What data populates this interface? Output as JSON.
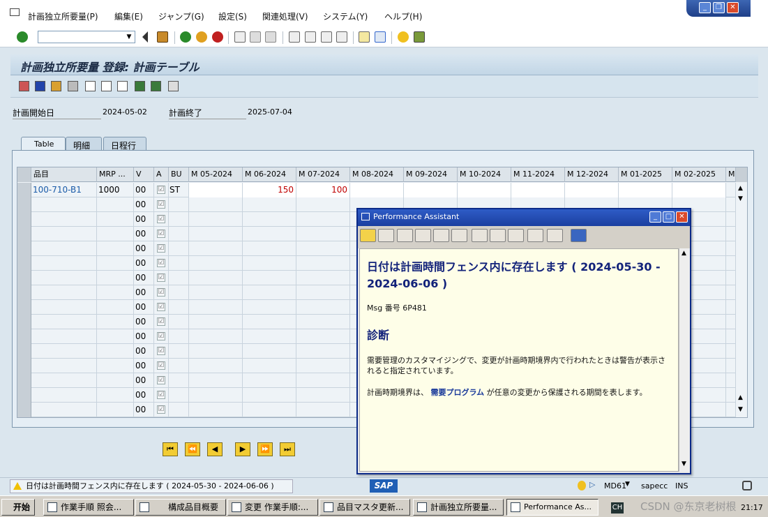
{
  "menu": [
    "計画独立所要量(P)",
    "編集(E)",
    "ジャンプ(G)",
    "設定(S)",
    "関連処理(V)",
    "システム(Y)",
    "ヘルプ(H)"
  ],
  "screen_title": "計画独立所要量 登録:  計画テーブル",
  "fields": {
    "start_label": "計画開始日",
    "start_value": "2024-05-02",
    "end_label": "計画終了",
    "end_value": "2025-07-04"
  },
  "tabs": [
    "Table",
    "明細",
    "日程行"
  ],
  "table": {
    "headers": [
      "品目",
      "MRP ...",
      "V",
      "A",
      "BU",
      "M 05-2024",
      "M 06-2024",
      "M 07-2024",
      "M 08-2024",
      "M 09-2024",
      "M 10-2024",
      "M 11-2024",
      "M 12-2024",
      "M 01-2025",
      "M 02-2025",
      "M."
    ],
    "first_row": {
      "item": "100-710-B1",
      "mrp": "1000",
      "v": "00",
      "a": "☑",
      "bu": "ST",
      "m06": "150",
      "m07": "100"
    },
    "other_v": "00",
    "check": "☑"
  },
  "nav_buttons": [
    "⏮",
    "⏪",
    "◀",
    "▶",
    "⏩",
    "⏭"
  ],
  "status": {
    "message": "日付は計画時間フェンス内に存在します ( 2024-05-30 - 2024-06-06 )",
    "sap_logo": "SAP",
    "transaction": "MD61",
    "system": "sapecc",
    "mode": "INS"
  },
  "popup": {
    "title": "Performance Assistant",
    "heading": "日付は計画時間フェンス内に存在します ( 2024-05-30 - 2024-06-06 )",
    "msg_no": "Msg 番号  6P481",
    "diag_title": "診断",
    "diag_text": "需要管理のカスタマイジングで、変更が計画時期境界内で行われたときは警告が表示されると指定されています。",
    "p2_before": "計画時期境界は、  ",
    "p2_link": "需要プログラム",
    "p2_after": " が任意の変更から保護される期間を表します。"
  },
  "taskbar": {
    "start": "开始",
    "tasks": [
      "作業手順 照会...",
      "構成品目概要",
      "変更 作業手順:...",
      "品目マスタ更新...",
      "計画独立所要量...",
      "Performance As..."
    ],
    "lang": "CH",
    "watermark": "CSDN @东京老树根",
    "clock": "21:17"
  }
}
